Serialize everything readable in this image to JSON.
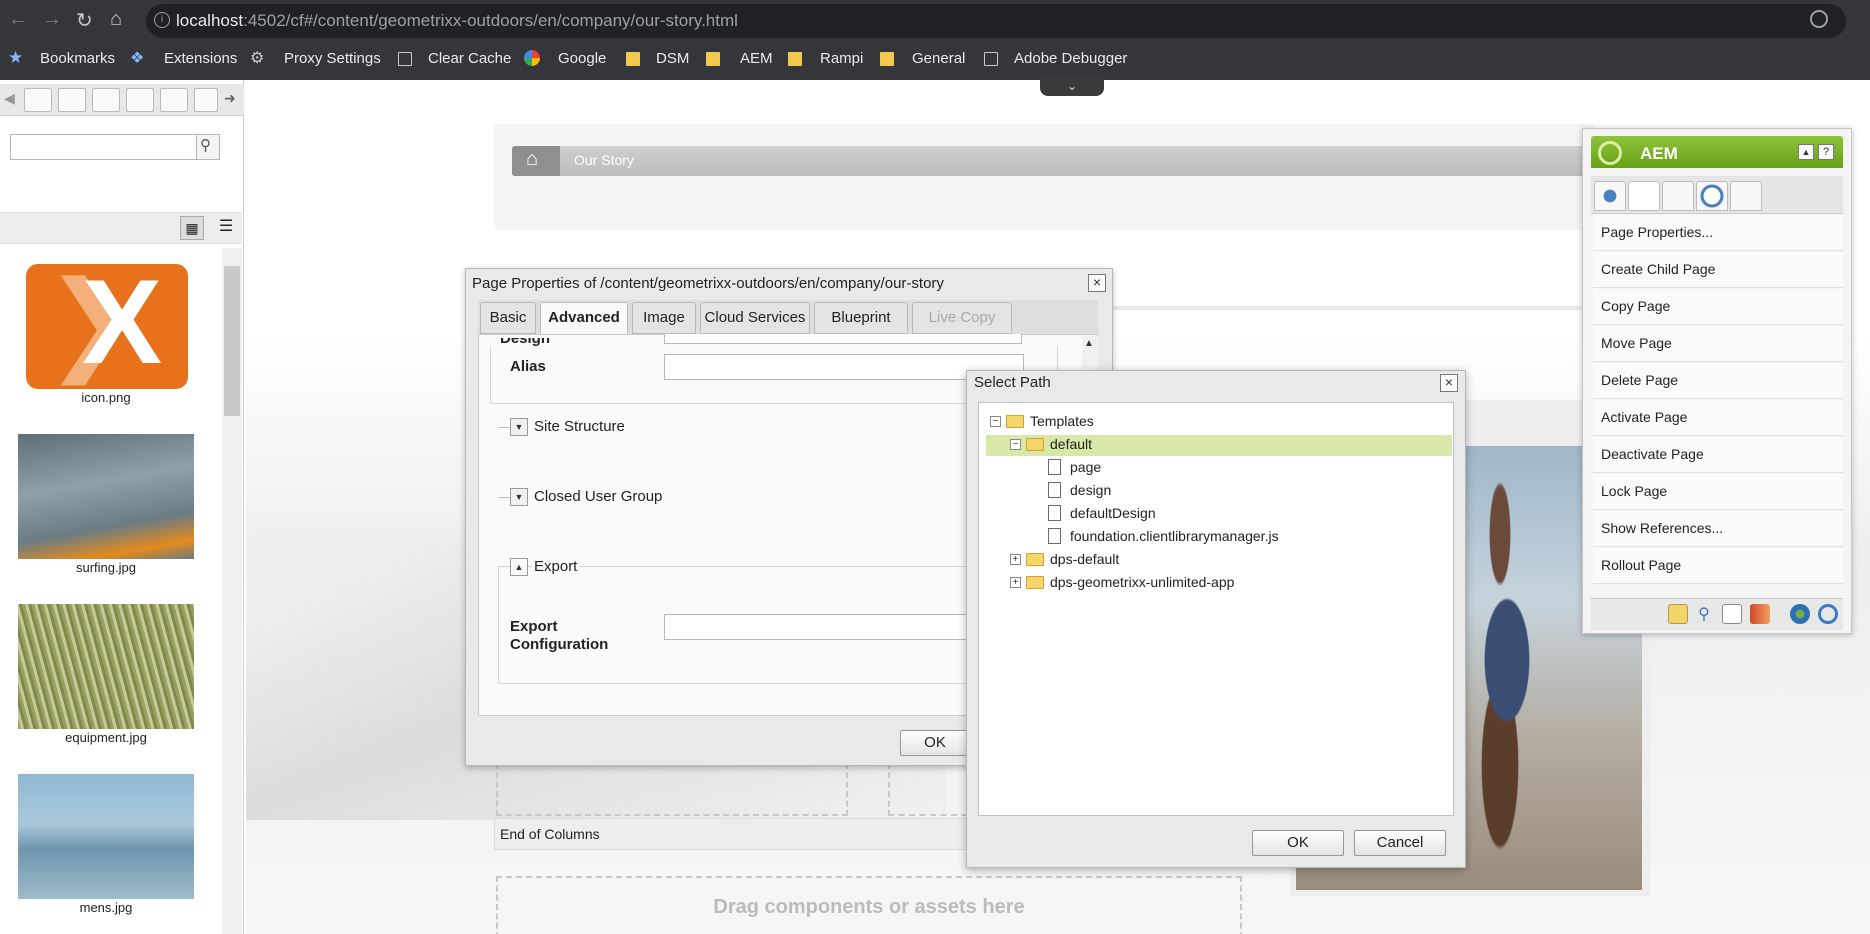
{
  "browser": {
    "url_host": "localhost",
    "url_rest": ":4502/cf#/content/geometrixx-outdoors/en/company/our-story.html",
    "bookmarks": [
      "Bookmarks",
      "Extensions",
      "Proxy Settings",
      "Clear Cache",
      "Google",
      "DSM",
      "AEM",
      "Rampi",
      "General",
      "Adobe Debugger"
    ]
  },
  "sidekick_left": {
    "search_placeholder": "",
    "assets": [
      {
        "label": "icon.png"
      },
      {
        "label": "surfing.jpg"
      },
      {
        "label": "equipment.jpg"
      },
      {
        "label": "mens.jpg"
      }
    ]
  },
  "page": {
    "breadcrumb": "Our Story",
    "drop_hint": "Drag components or assets here",
    "end_of_columns": "End of Columns"
  },
  "page_properties": {
    "title": "Page Properties of /content/geometrixx-outdoors/en/company/our-story",
    "tabs": [
      "Basic",
      "Advanced",
      "Image",
      "Cloud Services",
      "Blueprint",
      "Live Copy"
    ],
    "active_tab": "Advanced",
    "partial_label": "Design",
    "alias_label": "Alias",
    "sections": [
      "Site Structure",
      "Closed User Group",
      "Export"
    ],
    "export_config_label_1": "Export",
    "export_config_label_2": "Configuration",
    "ok": "OK"
  },
  "select_path": {
    "title": "Select Path",
    "tree": {
      "root": "Templates",
      "selected": "default",
      "children_of_default": [
        "page",
        "design",
        "defaultDesign",
        "foundation.clientlibrarymanager.js"
      ],
      "siblings": [
        "dps-default",
        "dps-geometrixx-unlimited-app"
      ]
    },
    "ok": "OK",
    "cancel": "Cancel"
  },
  "aem_sidekick": {
    "title": "AEM",
    "items": [
      "Page Properties...",
      "Create Child Page",
      "Copy Page",
      "Move Page",
      "Delete Page",
      "Activate Page",
      "Deactivate Page",
      "Lock Page",
      "Show References...",
      "Rollout Page"
    ]
  }
}
